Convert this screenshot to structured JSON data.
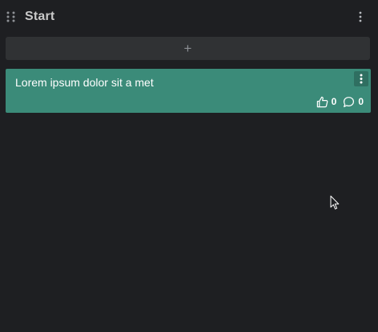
{
  "column": {
    "title": "Start",
    "drag_icon": "drag-handle-icon",
    "menu_icon": "kebab-menu-icon"
  },
  "add_card": {
    "label": "+"
  },
  "cards": [
    {
      "title": "Lorem ipsum dolor sit a met",
      "likes": "0",
      "comments": "0",
      "color": "#3b8b79"
    }
  ],
  "colors": {
    "background": "#1e1f22",
    "add_bar": "#303234",
    "card_accent": "#3b8b79"
  }
}
